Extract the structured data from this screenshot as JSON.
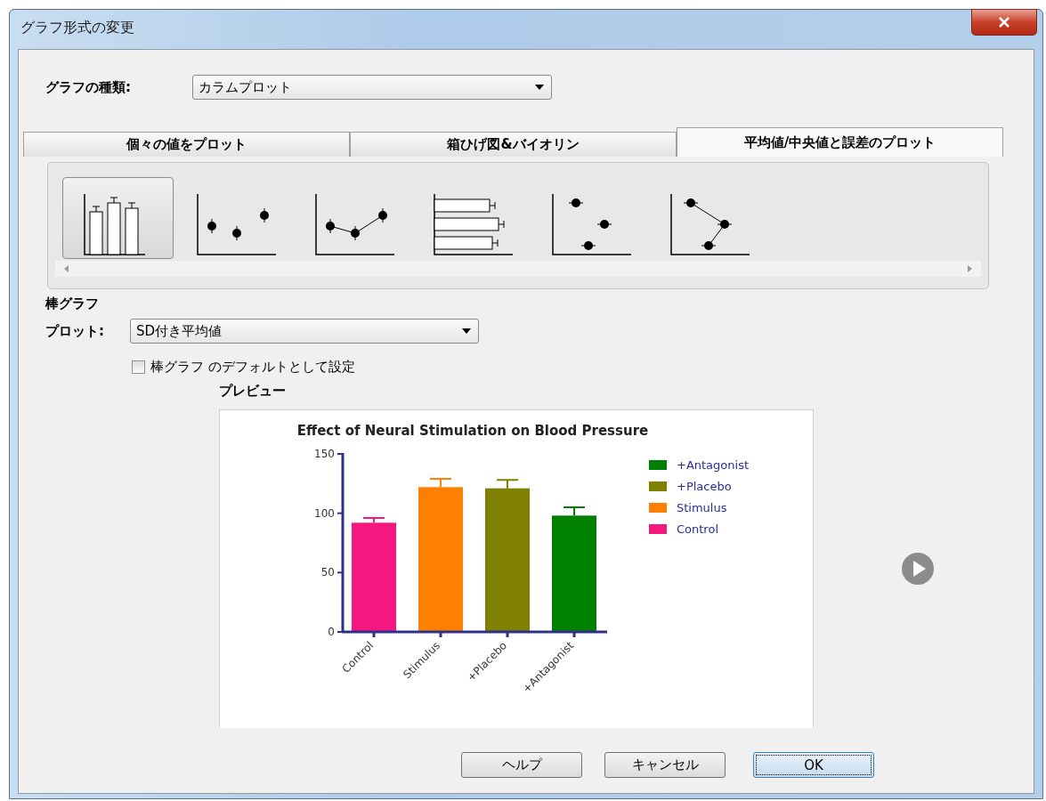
{
  "window": {
    "title": "グラフ形式の変更"
  },
  "graph_type": {
    "label": "グラフの種類:",
    "value": "カラムプロット"
  },
  "tabs": [
    {
      "label": "個々の値をプロット",
      "selected": false
    },
    {
      "label": "箱ひげ図&バイオリン",
      "selected": false
    },
    {
      "label": "平均値/中央値と誤差のプロット",
      "selected": true
    }
  ],
  "gallery": [
    {
      "kind": "bars",
      "selected": true
    },
    {
      "kind": "points",
      "selected": false
    },
    {
      "kind": "line",
      "selected": false
    },
    {
      "kind": "hbars",
      "selected": false
    },
    {
      "kind": "hpoints",
      "selected": false
    },
    {
      "kind": "hline",
      "selected": false
    }
  ],
  "section_title": "棒グラフ",
  "plot": {
    "label": "プロット:",
    "value": "SD付き平均値"
  },
  "default_checkbox": {
    "label": "棒グラフ のデフォルトとして設定",
    "checked": false
  },
  "preview": {
    "label": "プレビュー",
    "chart_data": {
      "type": "bar",
      "title": "Effect of Neural Stimulation on Blood Pressure",
      "categories": [
        "Control",
        "Stimulus",
        "+Placebo",
        "+Antagonist"
      ],
      "ylim": [
        0,
        150
      ],
      "yticks": [
        0,
        50,
        100,
        150
      ],
      "legend": true,
      "series": [
        {
          "name": "Control",
          "color": "#f5167f",
          "values": [
            92,
            null,
            null,
            null
          ],
          "errors": [
            4,
            null,
            null,
            null
          ]
        },
        {
          "name": "Stimulus",
          "color": "#ff8000",
          "values": [
            null,
            122,
            null,
            null
          ],
          "errors": [
            null,
            7,
            null,
            null
          ]
        },
        {
          "name": "+Placebo",
          "color": "#808000",
          "values": [
            null,
            null,
            121,
            null
          ],
          "errors": [
            null,
            null,
            7,
            null
          ]
        },
        {
          "name": "+Antagonist",
          "color": "#008000",
          "values": [
            null,
            null,
            null,
            98
          ],
          "errors": [
            null,
            null,
            null,
            7
          ]
        }
      ]
    }
  },
  "buttons": [
    {
      "label": "ヘルプ",
      "selected": false
    },
    {
      "label": "キャンセル",
      "selected": false
    },
    {
      "label": "OK",
      "selected": true
    }
  ]
}
